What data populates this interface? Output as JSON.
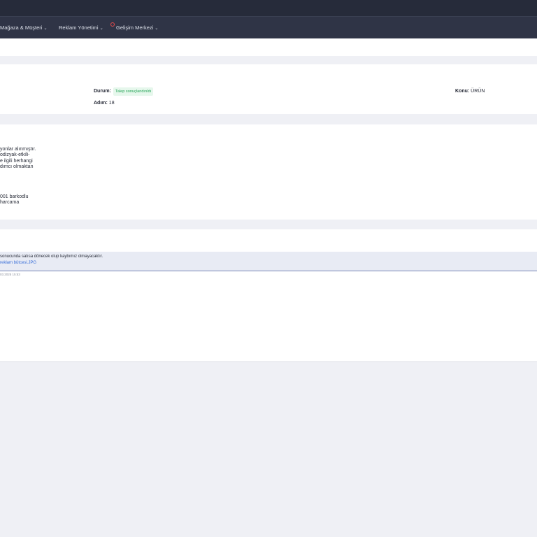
{
  "nav": {
    "items": [
      {
        "label": "Mağaza & Müşteri"
      },
      {
        "label": "Reklam Yönetimi"
      },
      {
        "label": "Gelişim Merkezi"
      }
    ]
  },
  "ticket": {
    "status_label": "Durum:",
    "status_value": "Talep sonuçlandırıldı",
    "step_label": "Adım:",
    "step_value": "18",
    "subject_label": "Konu:",
    "subject_value": "ÜRÜN"
  },
  "description": {
    "lines": [
      "yonlar alınmıştır.",
      "odizyak-etkili-",
      "e ilgili herhangi",
      "dımcı olmaktan",
      "001 barkodlu",
      "harcama"
    ]
  },
  "message": {
    "text": "sonucunda satısa dönecek olup kaybımız olmayacaktır.",
    "attachment": "reklam bütcesi.JPG",
    "timestamp": "03.2025 15:53"
  },
  "colors": {
    "topbar": "#262b3a",
    "navbar": "#2f3446",
    "status_badge_bg": "#e6f7ec",
    "status_badge_text": "#23a455",
    "link": "#3a6fd8",
    "notification_dot": "#e84a4a"
  }
}
